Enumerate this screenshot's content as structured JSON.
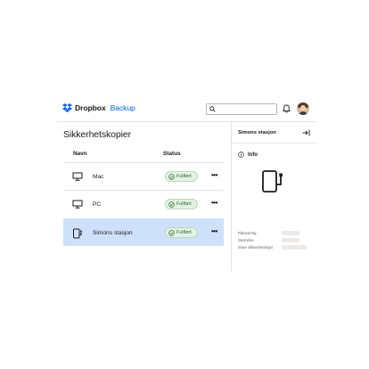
{
  "header": {
    "brand": "Dropbox",
    "brand_sub": "Backup",
    "search_placeholder": ""
  },
  "main": {
    "title": "Sikkerhetskopier",
    "columns": {
      "name": "Navn",
      "status": "Status"
    },
    "rows": [
      {
        "name": "Mac",
        "icon": "desktop-icon",
        "status": "Fullført",
        "selected": false
      },
      {
        "name": "PC",
        "icon": "desktop-icon",
        "status": "Fullført",
        "selected": false
      },
      {
        "name": "Simons stasjon",
        "icon": "external-drive-icon",
        "status": "Fullført",
        "selected": true
      }
    ],
    "more_label": "•••"
  },
  "panel": {
    "title": "Simons stasjon",
    "info_label": "Info",
    "meta_labels": [
      "Plassering",
      "Størrelse",
      "Siste sikkerhetskopi"
    ]
  },
  "colors": {
    "accent": "#0061fe",
    "selected_row": "#cfe0fb",
    "success_bg": "#e3f1e4",
    "success_text": "#2c6e31"
  }
}
